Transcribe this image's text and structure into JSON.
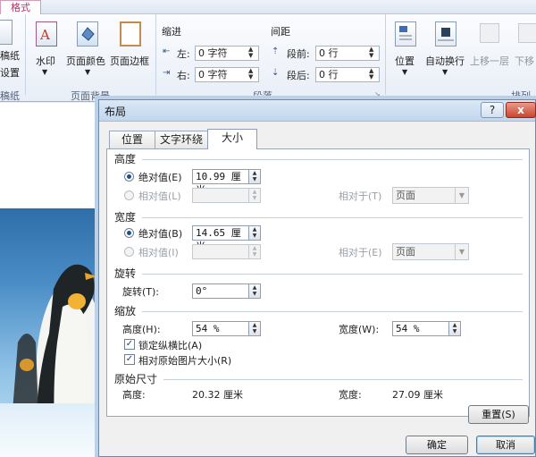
{
  "ribbon": {
    "format_tab": "格式",
    "left_partial_1": "稿纸",
    "left_partial_2": "设置",
    "left_partial_group": "稿纸",
    "watermark": "水印",
    "page_color": "页面颜色",
    "page_border": "页面边框",
    "page_background_group": "页面背景",
    "indent_title": "缩进",
    "indent_left_label": "左:",
    "indent_left_value": "0 字符",
    "indent_right_label": "右:",
    "indent_right_value": "0 字符",
    "spacing_title": "间距",
    "spacing_before_label": "段前:",
    "spacing_before_value": "0 行",
    "spacing_after_label": "段后:",
    "spacing_after_value": "0 行",
    "paragraph_group": "段落",
    "position": "位置",
    "wrap_text": "自动换行",
    "bring_forward": "上移一层",
    "send_backward": "下移",
    "arrange_group": "排列"
  },
  "dialog": {
    "title": "布局",
    "help": "?",
    "close": "x",
    "tabs": [
      "位置",
      "文字环绕",
      "大小"
    ],
    "height": {
      "title": "高度",
      "absolute_label": "绝对值(E)",
      "absolute_value": "10.99 厘米",
      "relative_label": "相对值(L)",
      "relative_to_label": "相对于(T)",
      "relative_to_value": "页面"
    },
    "width": {
      "title": "宽度",
      "absolute_label": "绝对值(B)",
      "absolute_value": "14.65 厘米",
      "relative_label": "相对值(I)",
      "relative_to_label": "相对于(E)",
      "relative_to_value": "页面"
    },
    "rotate": {
      "title": "旋转",
      "label": "旋转(T):",
      "value": "0°"
    },
    "scale": {
      "title": "缩放",
      "height_label": "高度(H):",
      "height_value": "54 %",
      "width_label": "宽度(W):",
      "width_value": "54 %",
      "lock_aspect": "锁定纵横比(A)",
      "relative_original": "相对原始图片大小(R)"
    },
    "original": {
      "title": "原始尺寸",
      "height_label": "高度:",
      "height_value": "20.32 厘米",
      "width_label": "宽度:",
      "width_value": "27.09 厘米"
    },
    "reset": "重置(S)",
    "ok": "确定",
    "cancel": "取消"
  }
}
